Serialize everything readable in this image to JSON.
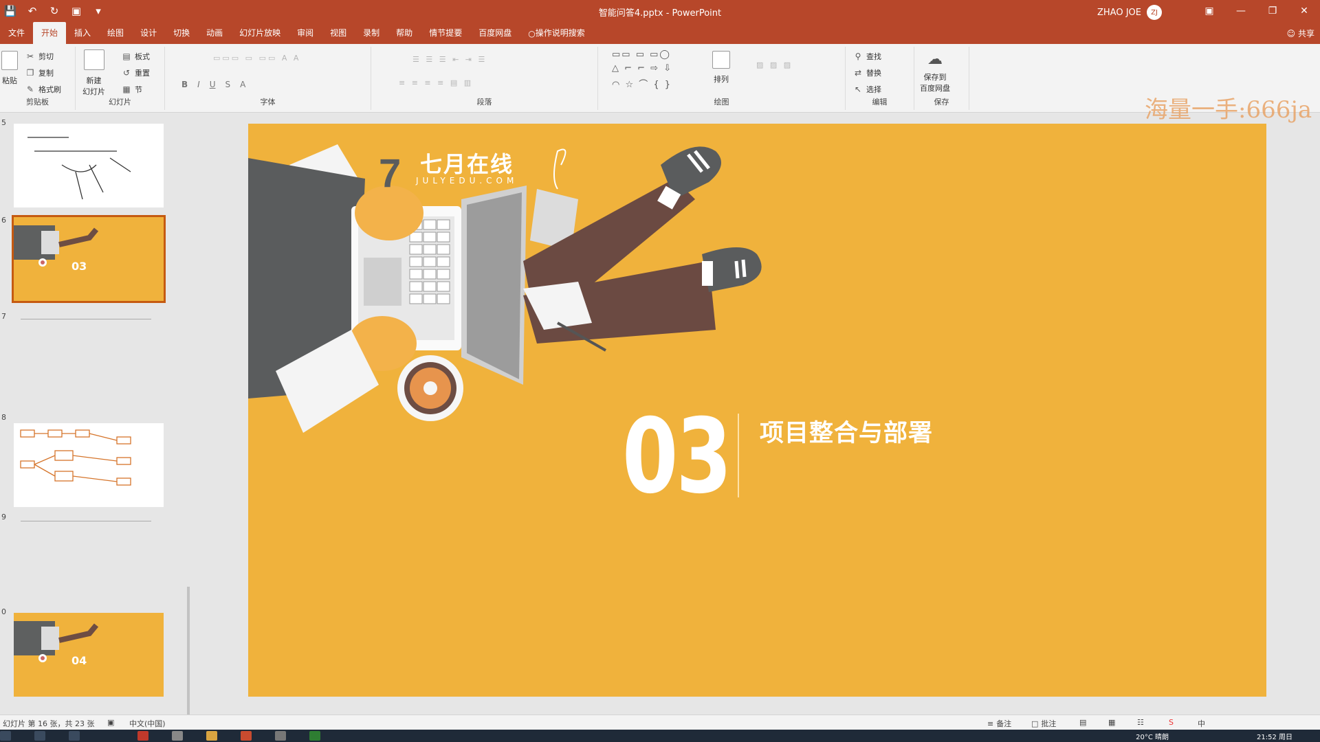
{
  "window": {
    "title": "智能问答4.pptx - PowerPoint",
    "user": "ZHAO JOE",
    "avatar_initials": "ZJ"
  },
  "qat": [
    "save-icon",
    "undo-icon",
    "redo-icon",
    "start-slideshow-icon",
    "customize-icon"
  ],
  "tabs": [
    "文件",
    "开始",
    "插入",
    "绘图",
    "设计",
    "切换",
    "动画",
    "幻灯片放映",
    "审阅",
    "视图",
    "录制",
    "帮助",
    "情节提要",
    "百度网盘",
    "操作说明搜索"
  ],
  "active_tab": "开始",
  "share_label": "共享",
  "ribbon": {
    "clipboard": {
      "paste": "粘贴",
      "cut": "剪切",
      "copy": "复制",
      "format_painter": "格式刷",
      "label": "剪贴板"
    },
    "slides": {
      "new_slide": "新建\n幻灯片",
      "layout": "板式",
      "reset": "重置",
      "section": "节",
      "label": "幻灯片"
    },
    "font": {
      "label": "字体",
      "bold": "B",
      "italic": "I",
      "underline": "U",
      "strike": "S",
      "shadow": "A"
    },
    "paragraph": {
      "label": "段落"
    },
    "drawing": {
      "label": "绘图",
      "arrange": "排列"
    },
    "editing": {
      "find": "查找",
      "replace": "替换",
      "select": "选择",
      "label": "编辑"
    },
    "save": {
      "save_to_baidu": "保存到\n百度网盘",
      "label": "保存"
    }
  },
  "thumbnails": [
    {
      "num": "5",
      "kind": "sketch"
    },
    {
      "num": "6",
      "kind": "orange",
      "selected": true,
      "number": "03"
    },
    {
      "num": "7",
      "kind": "blank"
    },
    {
      "num": "8",
      "kind": "diagram"
    },
    {
      "num": "9",
      "kind": "blank"
    },
    {
      "num": "0",
      "kind": "orange",
      "number": "04"
    }
  ],
  "slide": {
    "brand_cn": "七月在线",
    "brand_en": "JULYEDU.COM",
    "number": "03",
    "title": "项目整合与部署",
    "background": "#f0b23c"
  },
  "watermark": "海量一手:666ja",
  "status": {
    "slide_info": "幻灯片 第 16 张，共 23 张",
    "language": "中文(中国)",
    "notes": "备注",
    "comments": "批注"
  },
  "taskbar": {
    "time": "21:52 周日",
    "temp": "20°C 晴朗"
  }
}
